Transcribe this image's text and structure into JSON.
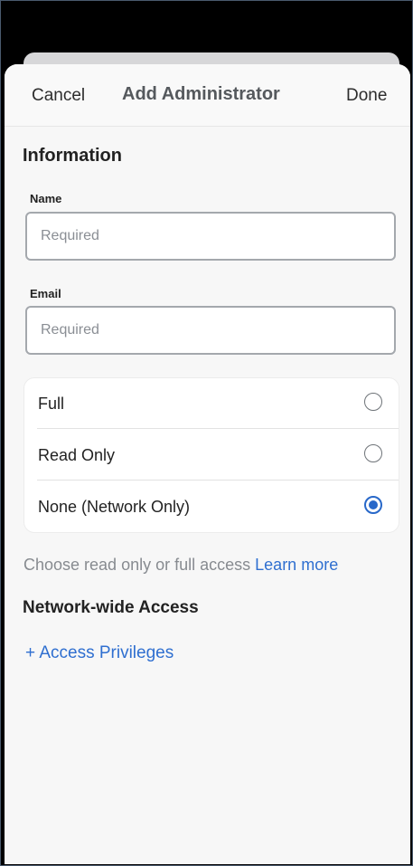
{
  "header": {
    "cancel_label": "Cancel",
    "title": "Add Administrator",
    "done_label": "Done"
  },
  "information": {
    "heading": "Information",
    "name": {
      "label": "Name",
      "value": "",
      "placeholder": "Required"
    },
    "email": {
      "label": "Email",
      "value": "",
      "placeholder": "Required"
    }
  },
  "access": {
    "options": [
      {
        "label": "Full",
        "selected": false,
        "icon": "radio-unselected-icon"
      },
      {
        "label": "Read Only",
        "selected": false,
        "icon": "radio-unselected-icon"
      },
      {
        "label": "None (Network Only)",
        "selected": true,
        "icon": "radio-selected-icon"
      }
    ],
    "help_text": "Choose read only or full access",
    "learn_more": "Learn more"
  },
  "network_access": {
    "heading": "Network-wide Access",
    "add_privileges_label": "+ Access Privileges"
  },
  "colors": {
    "accent": "#2f6fd0",
    "radio_selected": "#2868c9",
    "sheet_background": "#f7f7f7"
  }
}
